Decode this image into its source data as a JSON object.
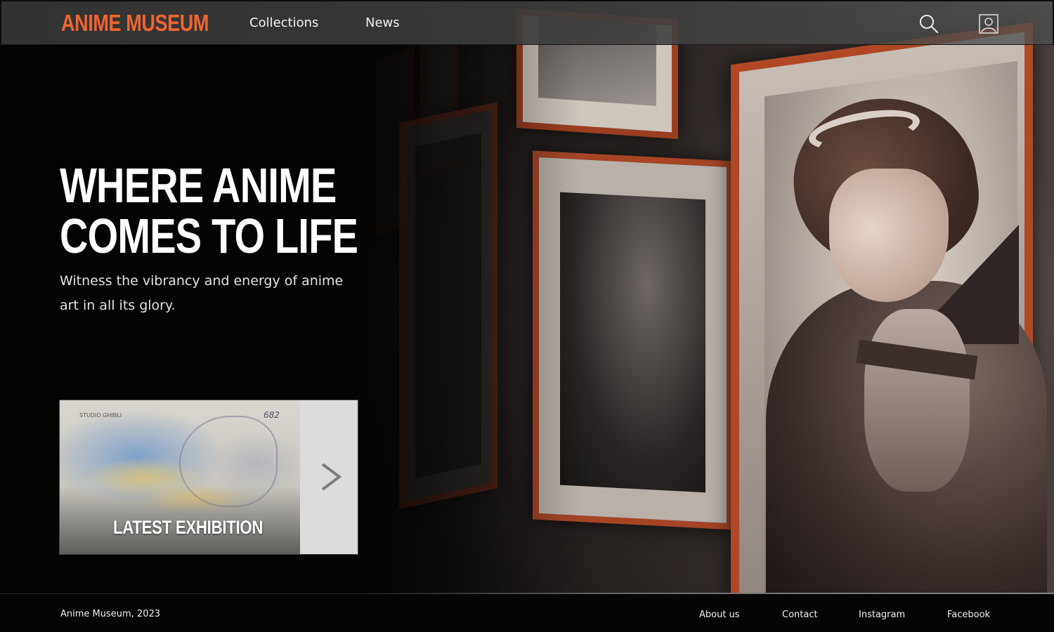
{
  "nav": {
    "logo": "ANIME MUSEUM",
    "links": [
      {
        "label": "Collections"
      },
      {
        "label": "News"
      }
    ],
    "icons": {
      "search": "search-icon",
      "user": "user-icon"
    }
  },
  "hero": {
    "headline": [
      "WHERE ANIME",
      "COMES TO LIFE"
    ],
    "tagline": "Witness the vibrancy and energy of anime art in all its glory.",
    "image": "anime-girl-in-gallery-illustration"
  },
  "exhibition_card": {
    "title": "LATEST EXHIBITION",
    "image_text": {
      "studio": "STUDIO GHIBLI",
      "number": "682"
    },
    "next_icon": "chevron-right-icon"
  },
  "footer": {
    "copyright": "Anime Museum, 2023",
    "links": [
      {
        "label": "About us"
      },
      {
        "label": "Contact"
      },
      {
        "label": "Instagram"
      },
      {
        "label": "Facebook"
      }
    ]
  },
  "colors": {
    "accent": "#f0642f",
    "background": "#050505",
    "frame": "#a54526"
  }
}
